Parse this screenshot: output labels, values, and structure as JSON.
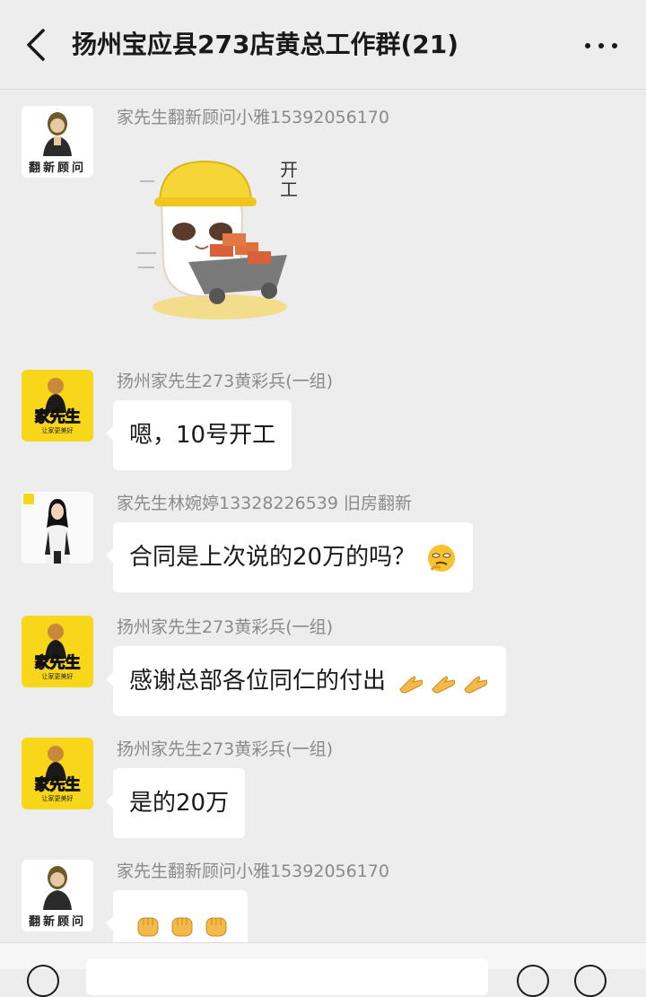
{
  "header": {
    "title": "扬州宝应县273店黄总工作群(21)"
  },
  "messages": [
    {
      "sender": "家先生翻新顾问小雅15392056170",
      "avatar_text": "翻新顾问",
      "type": "sticker",
      "sticker_text": "开工"
    },
    {
      "sender": "扬州家先生273黄彩兵(一组)",
      "avatar_text": "家先生",
      "avatar_sub": "让家更美好",
      "text": "嗯，10号开工"
    },
    {
      "sender": "家先生林婉婷13328226539 旧房翻新",
      "text": "合同是上次说的20万的吗？",
      "emoji": "thinking-face"
    },
    {
      "sender": "扬州家先生273黄彩兵(一组)",
      "avatar_text": "家先生",
      "avatar_sub": "让家更美好",
      "text": "感谢总部各位同仁的付出",
      "emoji": "clapping-hands x3"
    },
    {
      "sender": "扬州家先生273黄彩兵(一组)",
      "avatar_text": "家先生",
      "avatar_sub": "让家更美好",
      "text": "是的20万"
    },
    {
      "sender": "家先生翻新顾问小雅15392056170",
      "avatar_text": "翻新顾问",
      "emoji": "fist x3"
    }
  ],
  "colors": {
    "background": "#ededed",
    "bubble": "#ffffff",
    "sender": "#8a8a8a",
    "brand_yellow": "#f8d61a"
  }
}
